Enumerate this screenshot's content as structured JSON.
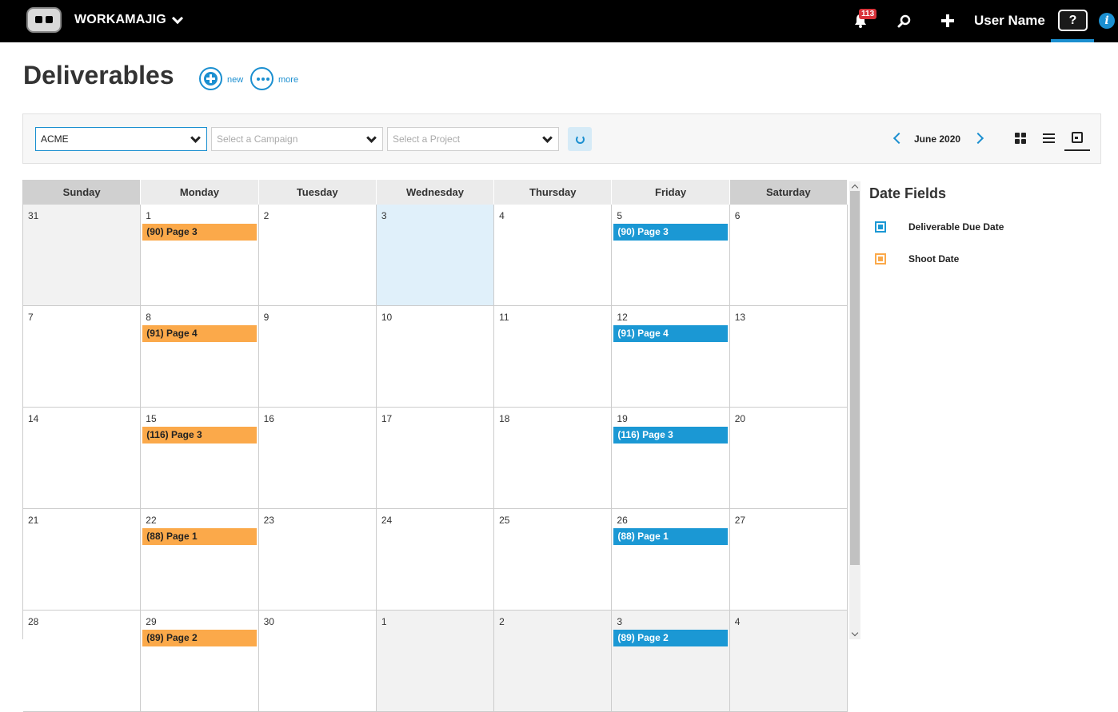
{
  "topbar": {
    "brand": "WORKAMAJIG",
    "notification_count": "113",
    "user_name": "User Name",
    "help_label": "?",
    "info_label": "i"
  },
  "header": {
    "title": "Deliverables",
    "new_label": "new",
    "more_label": "more"
  },
  "filters": {
    "client_value": "ACME",
    "campaign_placeholder": "Select a Campaign",
    "project_placeholder": "Select a Project",
    "month": "June 2020"
  },
  "calendar": {
    "weekdays": [
      "Sunday",
      "Monday",
      "Tuesday",
      "Wednesday",
      "Thursday",
      "Friday",
      "Saturday"
    ],
    "weeks": [
      [
        {
          "day": "31",
          "muted": true
        },
        {
          "day": "1",
          "event": "(90) Page 3",
          "kind": "shoot"
        },
        {
          "day": "2"
        },
        {
          "day": "3",
          "today": true
        },
        {
          "day": "4"
        },
        {
          "day": "5",
          "event": "(90) Page 3",
          "kind": "due"
        },
        {
          "day": "6"
        }
      ],
      [
        {
          "day": "7"
        },
        {
          "day": "8",
          "event": "(91) Page 4",
          "kind": "shoot"
        },
        {
          "day": "9"
        },
        {
          "day": "10"
        },
        {
          "day": "11"
        },
        {
          "day": "12",
          "event": "(91) Page 4",
          "kind": "due"
        },
        {
          "day": "13"
        }
      ],
      [
        {
          "day": "14"
        },
        {
          "day": "15",
          "event": "(116) Page 3",
          "kind": "shoot"
        },
        {
          "day": "16"
        },
        {
          "day": "17"
        },
        {
          "day": "18"
        },
        {
          "day": "19",
          "event": "(116) Page 3",
          "kind": "due"
        },
        {
          "day": "20"
        }
      ],
      [
        {
          "day": "21"
        },
        {
          "day": "22",
          "event": "(88) Page 1",
          "kind": "shoot"
        },
        {
          "day": "23"
        },
        {
          "day": "24"
        },
        {
          "day": "25"
        },
        {
          "day": "26",
          "event": "(88) Page 1",
          "kind": "due"
        },
        {
          "day": "27"
        }
      ],
      [
        {
          "day": "28"
        },
        {
          "day": "29",
          "event": "(89) Page 2",
          "kind": "shoot"
        },
        {
          "day": "30"
        },
        {
          "day": "1",
          "muted": true
        },
        {
          "day": "2",
          "muted": true
        },
        {
          "day": "3",
          "event": "(89) Page 2",
          "kind": "due",
          "muted": true
        },
        {
          "day": "4",
          "muted": true
        }
      ]
    ]
  },
  "legend": {
    "title": "Date Fields",
    "items": [
      {
        "label": "Deliverable Due Date",
        "kind": "due"
      },
      {
        "label": "Shoot Date",
        "kind": "shoot"
      }
    ]
  },
  "colors": {
    "accent": "#1b8fd0",
    "due": "#1b98d4",
    "shoot": "#fba94a",
    "today": "#e0f0fa"
  }
}
